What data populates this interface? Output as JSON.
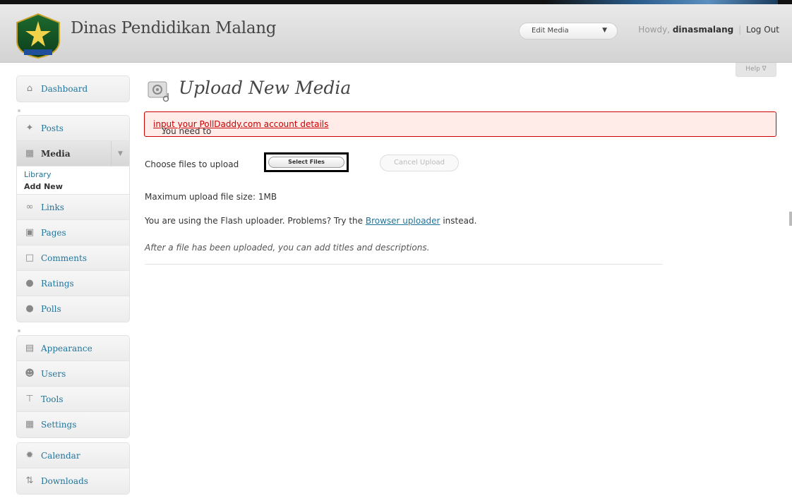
{
  "header": {
    "site_title": "Dinas Pendidikan Malang",
    "favorite_action": "Edit Media",
    "howdy_prefix": "Howdy,",
    "username": "dinasmalang",
    "logout": "Log Out"
  },
  "help_tab": "Help ∇",
  "sidebar": {
    "group1": [
      {
        "label": "Dashboard",
        "icon": "dashboard-icon"
      }
    ],
    "group2": [
      {
        "label": "Posts",
        "icon": "pin-icon"
      },
      {
        "label": "Media",
        "icon": "media-icon"
      }
    ],
    "media_submenu": [
      "Library",
      "Add New"
    ],
    "group2b": [
      {
        "label": "Links",
        "icon": "link-icon"
      },
      {
        "label": "Pages",
        "icon": "pages-icon"
      },
      {
        "label": "Comments",
        "icon": "comment-icon"
      },
      {
        "label": "Ratings",
        "icon": "ratings-icon"
      },
      {
        "label": "Polls",
        "icon": "polls-icon"
      }
    ],
    "group3": [
      {
        "label": "Appearance",
        "icon": "appearance-icon"
      },
      {
        "label": "Users",
        "icon": "users-icon"
      },
      {
        "label": "Tools",
        "icon": "tools-icon"
      },
      {
        "label": "Settings",
        "icon": "settings-icon"
      }
    ],
    "group4": [
      {
        "label": "Calendar",
        "icon": "calendar-icon"
      },
      {
        "label": "Downloads",
        "icon": "downloads-icon"
      }
    ]
  },
  "main": {
    "title": "Upload New Media",
    "notice_prefix": "You need to ",
    "notice_link": "input your PollDaddy.com account details",
    "notice_suffix": ".",
    "choose_label": "Choose files to upload",
    "select_files": "Select Files",
    "cancel_upload": "Cancel Upload",
    "max_size": "Maximum upload file size: 1MB",
    "flash_prefix": "You are using the Flash uploader. Problems? Try the ",
    "flash_link": "Browser uploader",
    "flash_suffix": " instead.",
    "after_text": "After a file has been uploaded, you can add titles and descriptions."
  },
  "colors": {
    "link": "#21759b",
    "notice_border": "#cc0000",
    "notice_bg": "#ffebe8"
  }
}
